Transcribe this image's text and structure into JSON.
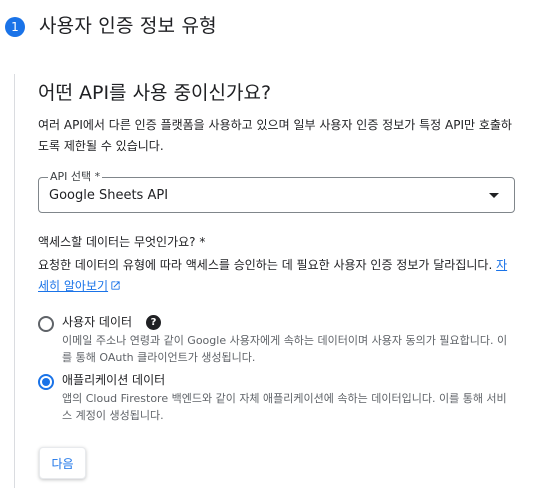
{
  "step": {
    "number": "1",
    "title": "사용자 인증 정보 유형"
  },
  "api_section": {
    "question": "어떤 API를 사용 중이신가요?",
    "description": "여러 API에서 다른 인증 플랫폼을 사용하고 있으며 일부 사용자 인증 정보가 특정 API만 호출하도록 제한될 수 있습니다.",
    "select_label": "API 선택 *",
    "select_value": "Google Sheets API"
  },
  "data_section": {
    "question": "액세스할 데이터는 무엇인가요? *",
    "description": "요청한 데이터의 유형에 따라 액세스를 승인하는 데 필요한 사용자 인증 정보가 달라집니다.",
    "learn_more": "자세히 알아보기",
    "options": [
      {
        "label": "사용자 데이터",
        "description": "이메일 주소나 연령과 같이 Google 사용자에게 속하는 데이터이며 사용자 동의가 필요합니다. 이를 통해 OAuth 클라이언트가 생성됩니다.",
        "checked": false
      },
      {
        "label": "애플리케이션 데이터",
        "description": "앱의 Cloud Firestore 백엔드와 같이 자체 애플리케이션에 속하는 데이터입니다. 이를 통해 서비스 계정이 생성됩니다.",
        "checked": true
      }
    ]
  },
  "help_icon": "question-circle-icon",
  "next_button": "다음",
  "colors": {
    "accent": "#1a73e8",
    "text": "#202124",
    "secondary_text": "#5f6368",
    "border": "#80868b"
  }
}
